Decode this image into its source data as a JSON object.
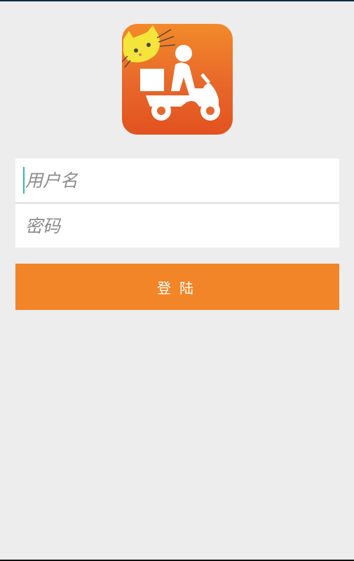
{
  "app": {
    "logo_icon": "delivery-scooter-cat-logo",
    "accent_color": "#f28527"
  },
  "form": {
    "username_placeholder": "用户名",
    "password_placeholder": "密码",
    "login_label": "登陆"
  }
}
